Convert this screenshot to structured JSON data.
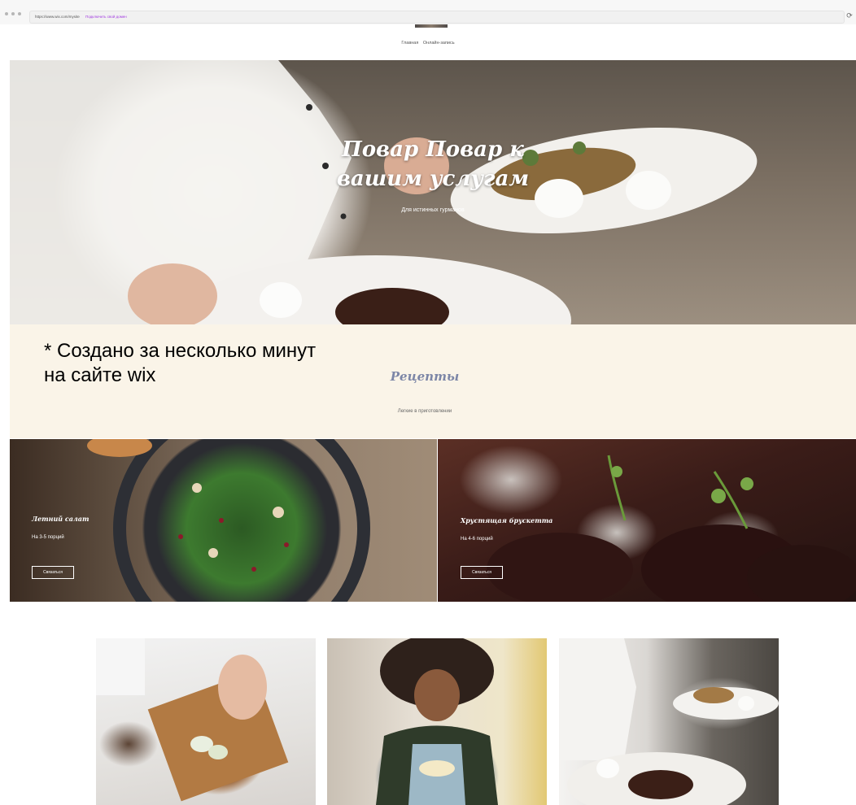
{
  "browser": {
    "url": "https://www.wix.com/mysite",
    "promo_link": "Подключить свой домен"
  },
  "nav": {
    "items": [
      "Главная",
      "Онлайн-запись"
    ]
  },
  "hero": {
    "title": "Повар Повар к вашим услугам",
    "subtitle": "Для истинных гурманов"
  },
  "recipes": {
    "caption": "* Создано за несколько минут\nна сайте wix",
    "title": "Рецепты",
    "subtitle": "Легкие в приготовлении",
    "cards": [
      {
        "title": "Летний салат",
        "portions": "На 3-5 порций",
        "button": "Связаться"
      },
      {
        "title": "Хрустящая брускетта",
        "portions": "На 4-6 порций",
        "button": "Связаться"
      }
    ]
  },
  "colors": {
    "accent_title": "#7c86a7",
    "band_background": "#faf4e8",
    "promo_link": "#a23ae0"
  }
}
